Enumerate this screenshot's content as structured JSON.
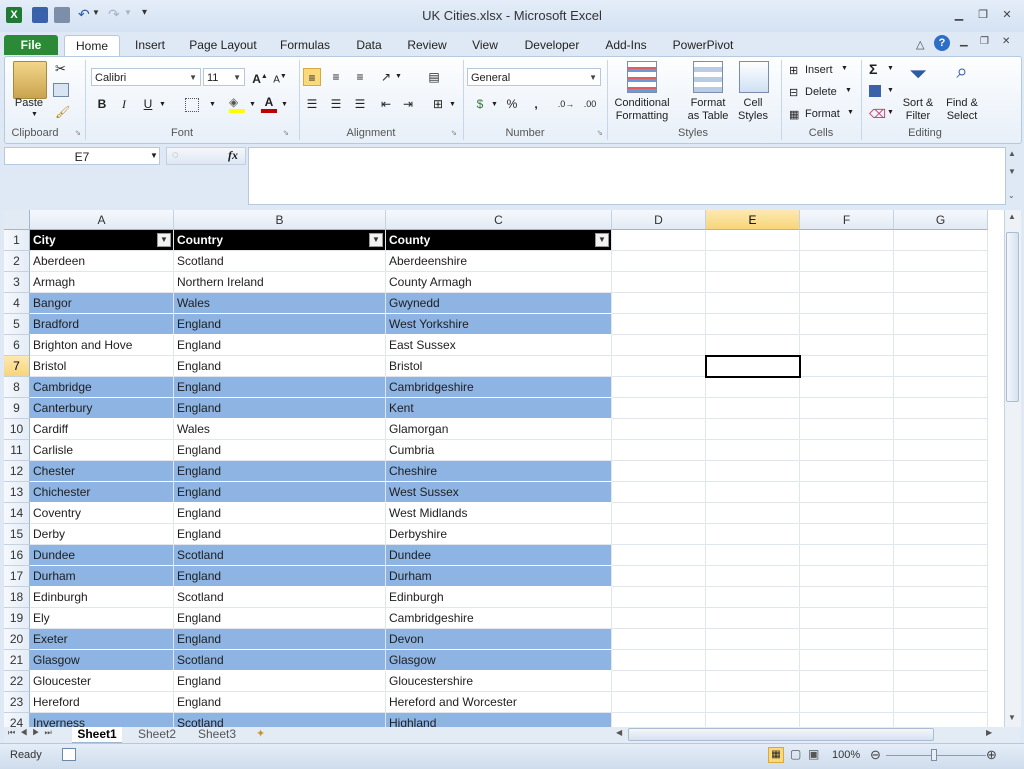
{
  "window": {
    "title": "UK Cities.xlsx - Microsoft Excel"
  },
  "tabs": [
    "File",
    "Home",
    "Insert",
    "Page Layout",
    "Formulas",
    "Data",
    "Review",
    "View",
    "Developer",
    "Add-Ins",
    "PowerPivot"
  ],
  "ribbon": {
    "clipboard": {
      "label": "Clipboard",
      "paste": "Paste"
    },
    "font": {
      "label": "Font",
      "family": "Calibri",
      "size": "11",
      "bold": "B",
      "italic": "I",
      "underline": "U"
    },
    "alignment": {
      "label": "Alignment"
    },
    "number": {
      "label": "Number",
      "format": "General",
      "percent": "%",
      "comma": ","
    },
    "styles": {
      "label": "Styles",
      "conditional": "Conditional",
      "conditional2": "Formatting",
      "format_table": "Format",
      "format_table2": "as Table",
      "cell_styles": "Cell",
      "cell_styles2": "Styles"
    },
    "cells": {
      "label": "Cells",
      "insert": "Insert",
      "delete": "Delete",
      "format": "Format"
    },
    "editing": {
      "label": "Editing",
      "sigma": "Σ",
      "sort": "Sort &",
      "sort2": "Filter",
      "find": "Find &",
      "find2": "Select"
    }
  },
  "formula_bar": {
    "name_box": "E7",
    "fx": "fx",
    "formula": ""
  },
  "columns": [
    "A",
    "B",
    "C",
    "D",
    "E",
    "F",
    "G"
  ],
  "rows": [
    {
      "n": "1",
      "city": "City",
      "country": "Country",
      "county": "County"
    },
    {
      "n": "2",
      "city": "Aberdeen",
      "country": "Scotland",
      "county": "Aberdeenshire"
    },
    {
      "n": "3",
      "city": "Armagh",
      "country": "Northern Ireland",
      "county": "County Armagh"
    },
    {
      "n": "4",
      "city": "Bangor",
      "country": "Wales",
      "county": "Gwynedd"
    },
    {
      "n": "5",
      "city": "Bradford",
      "country": "England",
      "county": "West Yorkshire"
    },
    {
      "n": "6",
      "city": "Brighton and Hove",
      "country": "England",
      "county": "East Sussex"
    },
    {
      "n": "7",
      "city": "Bristol",
      "country": "England",
      "county": "Bristol"
    },
    {
      "n": "8",
      "city": "Cambridge",
      "country": "England",
      "county": "Cambridgeshire"
    },
    {
      "n": "9",
      "city": "Canterbury",
      "country": "England",
      "county": "Kent"
    },
    {
      "n": "10",
      "city": "Cardiff",
      "country": "Wales",
      "county": "Glamorgan"
    },
    {
      "n": "11",
      "city": "Carlisle",
      "country": "England",
      "county": "Cumbria"
    },
    {
      "n": "12",
      "city": "Chester",
      "country": "England",
      "county": "Cheshire"
    },
    {
      "n": "13",
      "city": "Chichester",
      "country": "England",
      "county": "West Sussex"
    },
    {
      "n": "14",
      "city": "Coventry",
      "country": "England",
      "county": "West Midlands"
    },
    {
      "n": "15",
      "city": "Derby",
      "country": "England",
      "county": "Derbyshire"
    },
    {
      "n": "16",
      "city": "Dundee",
      "country": "Scotland",
      "county": "Dundee"
    },
    {
      "n": "17",
      "city": "Durham",
      "country": "England",
      "county": "Durham"
    },
    {
      "n": "18",
      "city": "Edinburgh",
      "country": "Scotland",
      "county": "Edinburgh"
    },
    {
      "n": "19",
      "city": "Ely",
      "country": "England",
      "county": "Cambridgeshire"
    },
    {
      "n": "20",
      "city": "Exeter",
      "country": "England",
      "county": "Devon"
    },
    {
      "n": "21",
      "city": "Glasgow",
      "country": "Scotland",
      "county": "Glasgow"
    },
    {
      "n": "22",
      "city": "Gloucester",
      "country": "England",
      "county": "Gloucestershire"
    },
    {
      "n": "23",
      "city": "Hereford",
      "country": "England",
      "county": "Hereford and Worcester"
    },
    {
      "n": "24",
      "city": "Inverness",
      "country": "Scotland",
      "county": "Highland"
    }
  ],
  "sheets": [
    "Sheet1",
    "Sheet2",
    "Sheet3"
  ],
  "status": {
    "ready": "Ready",
    "zoom": "100%"
  },
  "colors": {
    "band": "#8db4e2",
    "header": "#000000",
    "file_tab": "#2a8a36"
  }
}
